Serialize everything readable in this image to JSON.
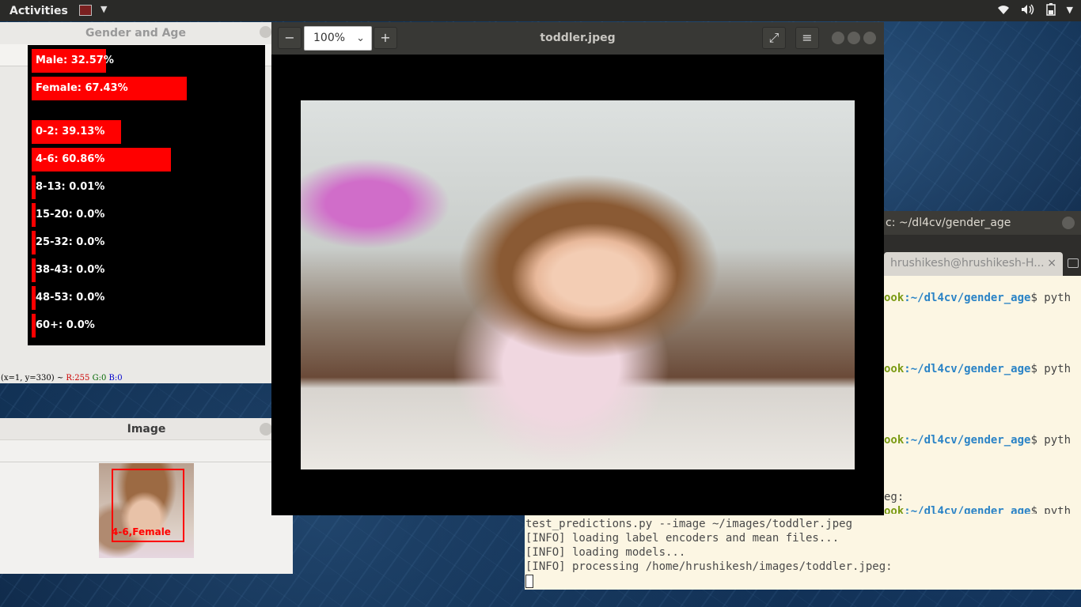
{
  "topbar": {
    "activities_label": "Activities"
  },
  "gender_age_window": {
    "title": "Gender and Age",
    "bars": [
      {
        "label": "Male: 32.57%",
        "value": 32.57,
        "group": "gender"
      },
      {
        "label": "Female: 67.43%",
        "value": 67.43,
        "group": "gender"
      },
      {
        "label": "0-2: 39.13%",
        "value": 39.13,
        "group": "age"
      },
      {
        "label": "4-6: 60.86%",
        "value": 60.86,
        "group": "age"
      },
      {
        "label": "8-13: 0.01%",
        "value": 0.01,
        "group": "age"
      },
      {
        "label": "15-20: 0.0%",
        "value": 0.0,
        "group": "age"
      },
      {
        "label": "25-32: 0.0%",
        "value": 0.0,
        "group": "age"
      },
      {
        "label": "38-43: 0.0%",
        "value": 0.0,
        "group": "age"
      },
      {
        "label": "48-53: 0.0%",
        "value": 0.0,
        "group": "age"
      },
      {
        "label": "60+: 0.0%",
        "value": 0.0,
        "group": "age"
      }
    ],
    "status": {
      "coords": "(x=1, y=330) ~",
      "r": "R:255",
      "g": "G:0",
      "b": "B:0"
    }
  },
  "image_window": {
    "title": "Image",
    "face_label": "4-6,Female"
  },
  "viewer": {
    "zoom": "100%",
    "title": "toddler.jpeg"
  },
  "terminal": {
    "title": "c: ~/dl4cv/gender_age",
    "tab_label": "hrushikesh@hrushikesh-H...",
    "tab_close": "×",
    "prompt_host_tail": "ook",
    "prompt_path": ":~/dl4cv/gender_age",
    "prompt_cmd": "$ pyth",
    "partial_line": "eg:",
    "output_lines": [
      " test_predictions.py --image ~/images/toddler.jpeg",
      "[INFO] loading label encoders and mean files...",
      "[INFO] loading models...",
      "[INFO] processing /home/hrushikesh/images/toddler.jpeg:"
    ]
  },
  "colors": {
    "bar": "#ff0000",
    "topbar": "#2a2a28",
    "terminal_bg": "#fcf6e3",
    "close_orange": "#e9541f"
  }
}
